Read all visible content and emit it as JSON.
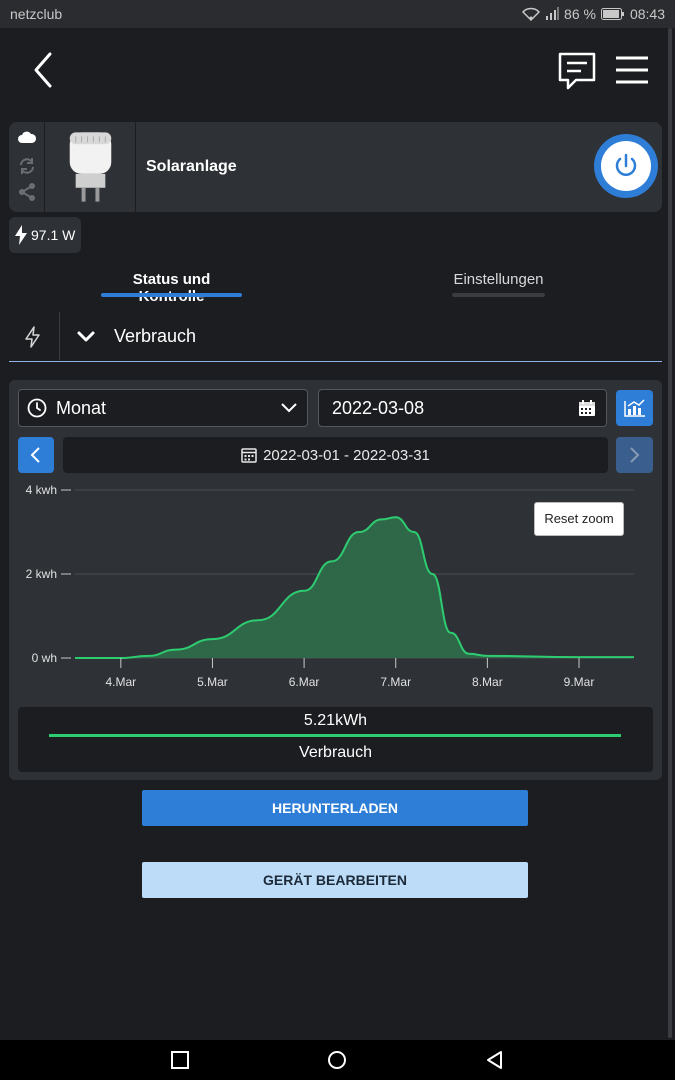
{
  "status_bar": {
    "carrier": "netzclub",
    "battery": "86 %",
    "time": "08:43"
  },
  "device": {
    "name": "Solaranlage",
    "power_reading": "97.1 W"
  },
  "tabs": [
    {
      "label": "Status und Kontrolle",
      "active": true
    },
    {
      "label": "Einstellungen",
      "active": false
    }
  ],
  "section": {
    "title": "Verbrauch"
  },
  "controls": {
    "period": "Monat",
    "date": "2022-03-08",
    "range": "2022-03-01 - 2022-03-31",
    "reset_zoom": "Reset zoom"
  },
  "chart_data": {
    "type": "area",
    "x": [
      "4.Mar",
      "5.Mar",
      "6.Mar",
      "7.Mar",
      "8.Mar",
      "9.Mar"
    ],
    "y_tick_labels": [
      "0 wh",
      "2 kwh",
      "4 kwh"
    ],
    "y_tick_values": [
      0,
      2,
      4
    ],
    "ylim": [
      0,
      4
    ],
    "unit": "kwh",
    "points": [
      {
        "x": 3.5,
        "y": 0
      },
      {
        "x": 4.0,
        "y": 0.0
      },
      {
        "x": 4.3,
        "y": 0.05
      },
      {
        "x": 4.6,
        "y": 0.2
      },
      {
        "x": 5.0,
        "y": 0.45
      },
      {
        "x": 5.5,
        "y": 0.9
      },
      {
        "x": 6.0,
        "y": 1.6
      },
      {
        "x": 6.3,
        "y": 2.3
      },
      {
        "x": 6.6,
        "y": 3.0
      },
      {
        "x": 6.85,
        "y": 3.3
      },
      {
        "x": 7.0,
        "y": 3.35
      },
      {
        "x": 7.2,
        "y": 3.0
      },
      {
        "x": 7.4,
        "y": 2.0
      },
      {
        "x": 7.6,
        "y": 0.6
      },
      {
        "x": 7.8,
        "y": 0.1
      },
      {
        "x": 8.0,
        "y": 0.05
      },
      {
        "x": 9.0,
        "y": 0.02
      },
      {
        "x": 9.6,
        "y": 0.02
      }
    ],
    "grid": true,
    "colors": {
      "line": "#2ecc71",
      "fill": "#2e6b4a"
    },
    "legend": {
      "total": "5.21kWh",
      "name": "Verbrauch"
    }
  },
  "buttons": {
    "download": "HERUNTERLADEN",
    "edit": "GERÄT BEARBEITEN"
  },
  "colors": {
    "accent": "#2e7ed8",
    "background": "#1c1d21",
    "panel": "#2e3136",
    "series": "#2ecc71"
  }
}
